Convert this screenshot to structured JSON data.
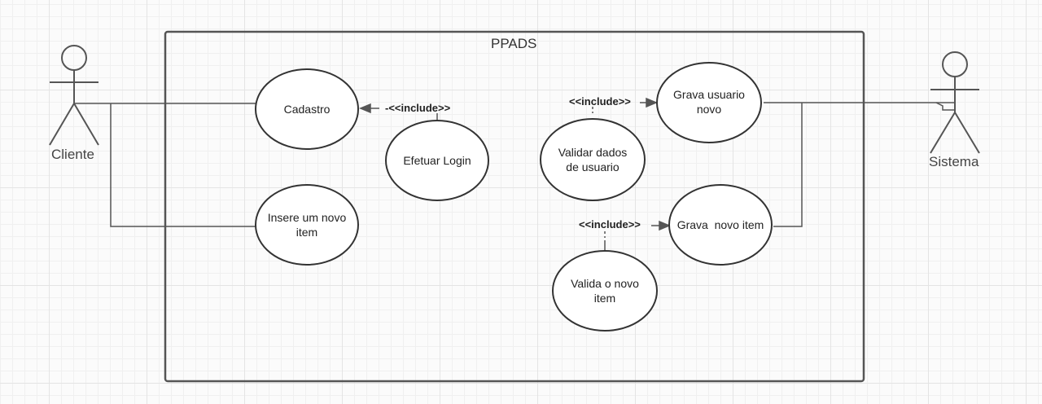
{
  "diagram": {
    "system_title": "PPADS",
    "actors": {
      "cliente": "Cliente",
      "sistema": "Sistema"
    },
    "use_cases": {
      "cadastro": "Cadastro",
      "efetuar_login": "Efetuar Login",
      "insere_item": "Insere um novo item",
      "validar_dados": "Validar dados de usuario",
      "grava_usuario": "Grava usuario novo",
      "grava_item": "Grava  novo item",
      "valida_item": "Valida o novo item"
    },
    "relations": {
      "include_login": "-<<include>>",
      "include_validar": "<<include>>",
      "include_valida_item": "<<include>>"
    }
  }
}
